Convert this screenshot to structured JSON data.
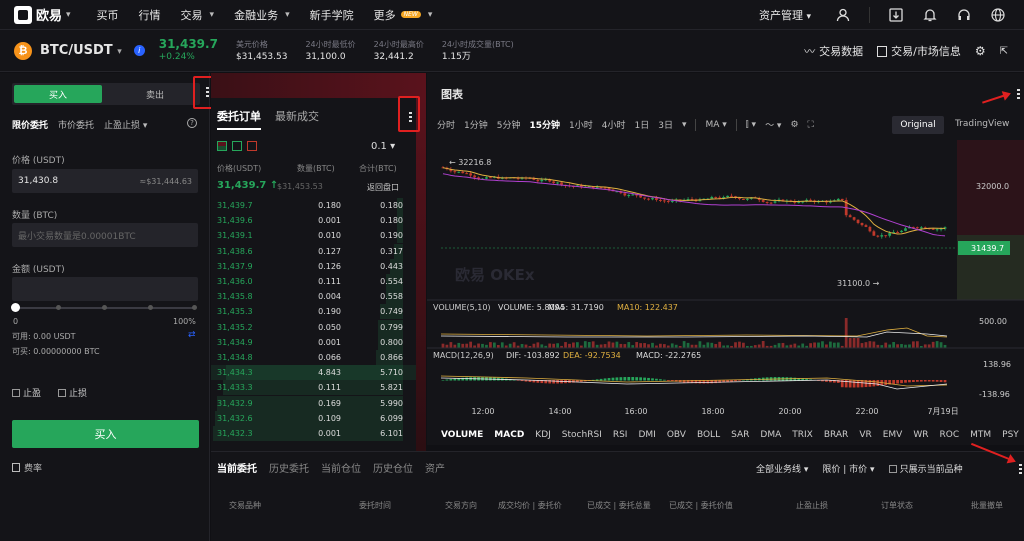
{
  "nav": {
    "brand": "欧易",
    "items": [
      {
        "label": "买币",
        "dropdown": false
      },
      {
        "label": "行情",
        "dropdown": false
      },
      {
        "label": "交易",
        "dropdown": true
      },
      {
        "label": "金融业务",
        "dropdown": true
      },
      {
        "label": "新手学院",
        "dropdown": false
      },
      {
        "label": "更多",
        "dropdown": true,
        "badge": "NEW"
      }
    ],
    "asset_mgmt": "资产管理",
    "icons": [
      "user-icon",
      "download-icon",
      "bell-icon",
      "headset-icon",
      "globe-icon"
    ]
  },
  "ticker": {
    "coin_icon": "₿",
    "pair": "BTC/USDT",
    "last_price": "31,439.7",
    "change_pct": "+0.24%",
    "stats": [
      {
        "label": "美元价格",
        "value": "$31,453.53"
      },
      {
        "label": "24小时最低价",
        "value": "31,100.0"
      },
      {
        "label": "24小时最高价",
        "value": "32,441.2"
      },
      {
        "label": "24小时成交量(BTC)",
        "value": "1.15万"
      }
    ],
    "trade_data": "交易数据",
    "market_info": "交易/市场信息"
  },
  "order_form": {
    "buy_tab": "买入",
    "sell_tab": "卖出",
    "types": [
      "限价委托",
      "市价委托",
      "止盈止损"
    ],
    "price_label": "价格 (USDT)",
    "price_value": "31,430.8",
    "price_usd": "≈$31,444.63",
    "qty_label": "数量 (BTC)",
    "qty_placeholder": "最小交易数量是0.00001BTC",
    "amount_label": "金额 (USDT)",
    "slider_min": "0",
    "slider_max": "100%",
    "available_usdt": "可用: 0.00 USDT",
    "available_btc": "可买: 0.00000000 BTC",
    "take_profit": "止盈",
    "stop_loss": "止损",
    "buy_button": "买入",
    "fee": "费率"
  },
  "orderbook": {
    "tab_active": "委托订单",
    "tab_other": "最新成交",
    "precision": "0.1",
    "col_price": "价格(USDT)",
    "col_qty": "数量(BTC)",
    "col_total": "合计(BTC)",
    "last_price": "31,439.7 ↑",
    "last_usd": "$31,453.53",
    "back_label": "返回盘口",
    "rows": [
      {
        "price": "31,439.7",
        "qty": "0.180",
        "total": "0.180",
        "depth": 0.03
      },
      {
        "price": "31,439.6",
        "qty": "0.001",
        "total": "0.180",
        "depth": 0.03
      },
      {
        "price": "31,439.1",
        "qty": "0.010",
        "total": "0.190",
        "depth": 0.03
      },
      {
        "price": "31,438.6",
        "qty": "0.127",
        "total": "0.317",
        "depth": 0.05
      },
      {
        "price": "31,437.9",
        "qty": "0.126",
        "total": "0.443",
        "depth": 0.07
      },
      {
        "price": "31,436.0",
        "qty": "0.111",
        "total": "0.554",
        "depth": 0.09
      },
      {
        "price": "31,435.8",
        "qty": "0.004",
        "total": "0.558",
        "depth": 0.09
      },
      {
        "price": "31,435.3",
        "qty": "0.190",
        "total": "0.749",
        "depth": 0.12
      },
      {
        "price": "31,435.2",
        "qty": "0.050",
        "total": "0.799",
        "depth": 0.13
      },
      {
        "price": "31,434.9",
        "qty": "0.001",
        "total": "0.800",
        "depth": 0.13
      },
      {
        "price": "31,434.8",
        "qty": "0.066",
        "total": "0.866",
        "depth": 0.14
      },
      {
        "price": "31,434.3",
        "qty": "4.843",
        "total": "5.710",
        "depth": 0.93
      },
      {
        "price": "31,433.3",
        "qty": "0.111",
        "total": "5.821",
        "depth": 0.95
      },
      {
        "price": "31,432.9",
        "qty": "0.169",
        "total": "5.990",
        "depth": 0.98
      },
      {
        "price": "31,432.6",
        "qty": "0.109",
        "total": "6.099",
        "depth": 0.99
      },
      {
        "price": "31,432.3",
        "qty": "0.001",
        "total": "6.101",
        "depth": 1.0
      }
    ]
  },
  "chart": {
    "title": "图表",
    "timeframes": [
      "分时",
      "1分钟",
      "5分钟",
      "15分钟",
      "1小时",
      "4小时",
      "1日",
      "3日"
    ],
    "active_tf": "15分钟",
    "ma_label": "MA",
    "view_original": "Original",
    "view_tv": "TradingView",
    "high_marker": "← 32216.8",
    "low_marker": "31100.0 →",
    "price_tag": "31439.7",
    "y_tick": "32000.0",
    "watermark": "欧易 OKEx",
    "volume_label": "VOLUME(5,10)",
    "volume_val": "VOLUME: 5.8094",
    "ma5": "MA5: 31.7190",
    "ma10": "MA10: 122.437",
    "vol_tick": "500.00",
    "macd_label": "MACD(12,26,9)",
    "dif": "DIF: -103.892",
    "dea": "DEA: -92.7534",
    "macd": "MACD: -22.2765",
    "macd_tick_top": "138.96",
    "macd_tick_bot": "-138.96",
    "x_ticks": [
      "12:00",
      "14:00",
      "16:00",
      "18:00",
      "20:00",
      "22:00",
      "7月19日"
    ],
    "indicators": [
      "VOLUME",
      "MACD",
      "KDJ",
      "StochRSI",
      "RSI",
      "DMI",
      "OBV",
      "BOLL",
      "SAR",
      "DMA",
      "TRIX",
      "BRAR",
      "VR",
      "EMV",
      "WR",
      "ROC",
      "MTM",
      "PSY"
    ]
  },
  "bottom": {
    "tabs": [
      "当前委托",
      "历史委托",
      "当前仓位",
      "历史仓位",
      "资产"
    ],
    "filter_business": "全部业务线",
    "filter_type": "限价 | 市价",
    "filter_only": "只展示当前品种",
    "headers": [
      "交易品种",
      "委托时间",
      "交易方向",
      "成交均价 | 委托价",
      "已成交 | 委托总量",
      "已成交 | 委托价值",
      "止盈止损",
      "订单状态",
      "批量撤单"
    ]
  }
}
